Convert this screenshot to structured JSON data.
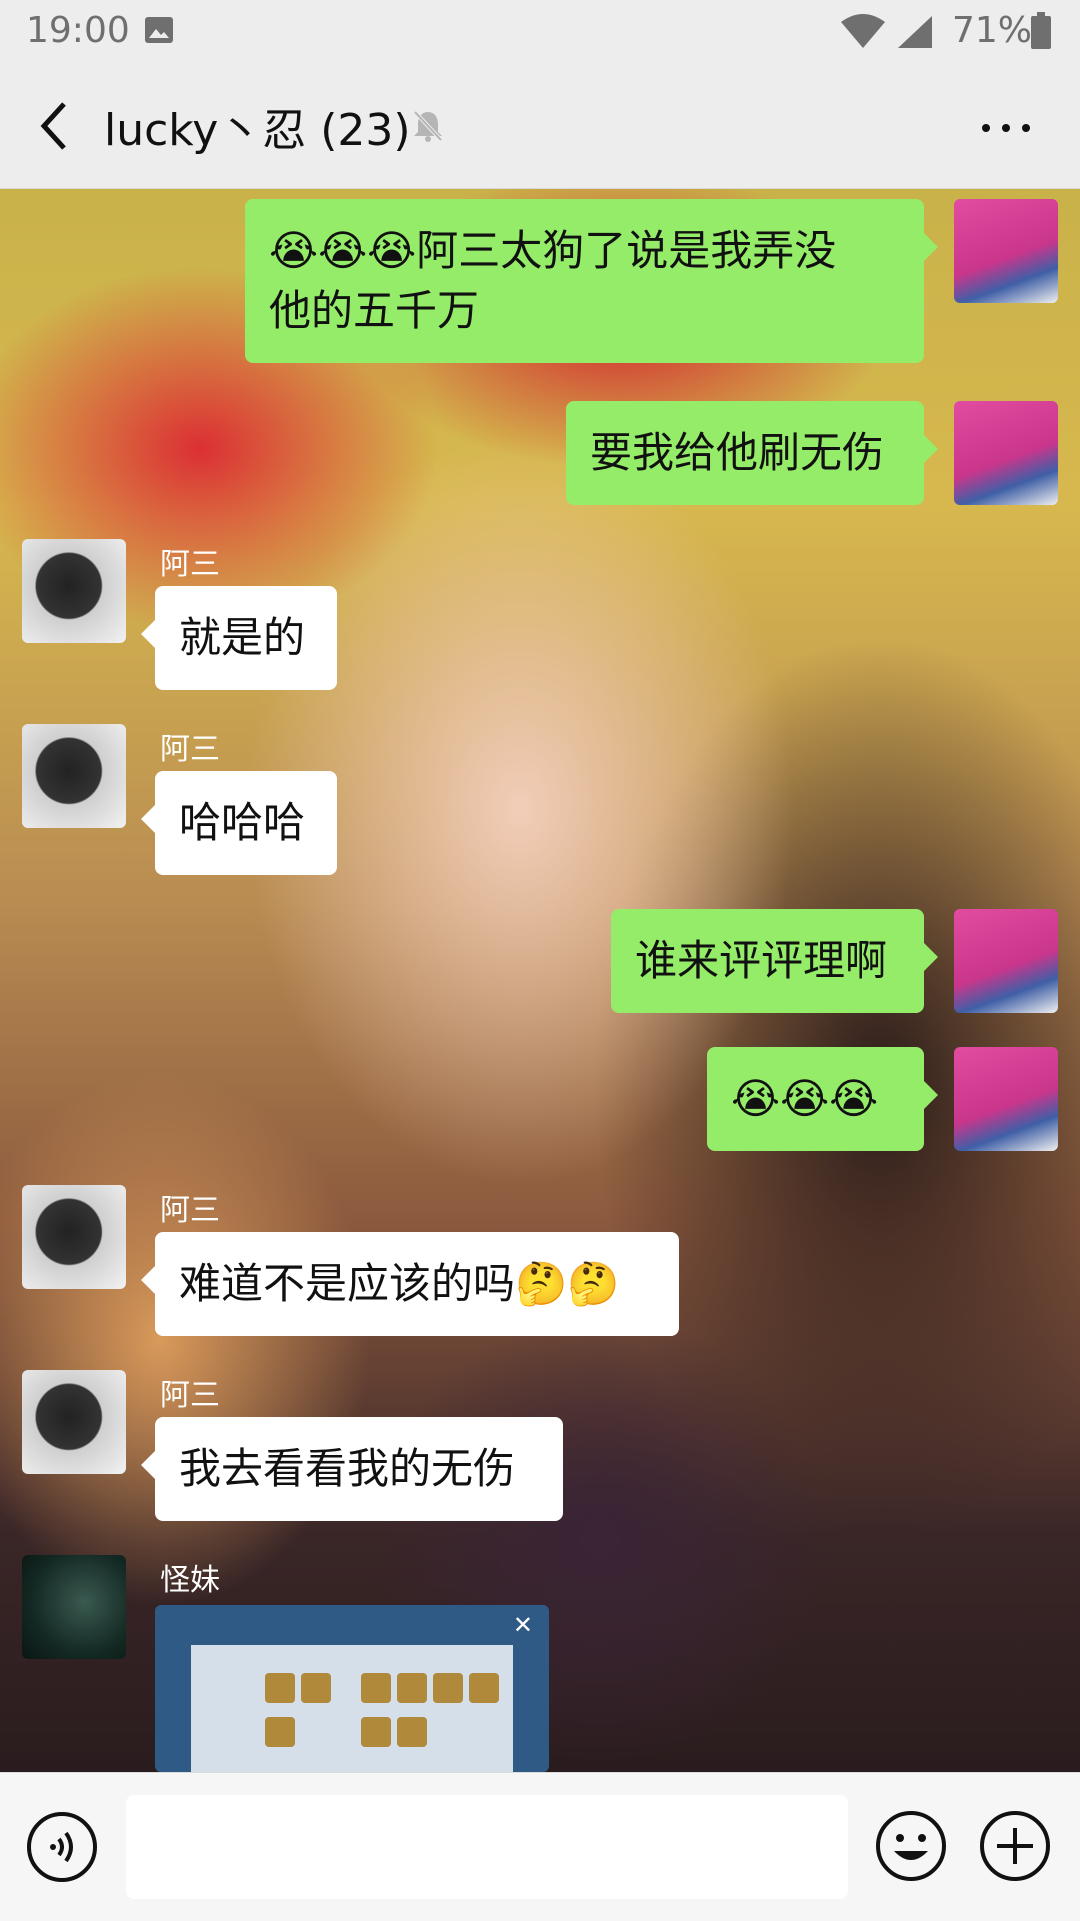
{
  "status_bar": {
    "time": "19:00",
    "battery_percent": "71%"
  },
  "header": {
    "title": "lucky丶忍 (23)",
    "back_icon": "chevron-left-icon",
    "mute_icon": "bell-off-icon",
    "more_icon": "more-dots-icon"
  },
  "colors": {
    "outgoing_bubble": "#95ec69",
    "incoming_bubble": "#ffffff",
    "bar_background": "#ededed"
  },
  "messages": [
    {
      "direction": "out",
      "text": "😭😭😭阿三太狗了说是我弄没\n他的五千万"
    },
    {
      "direction": "out",
      "text": "要我给他刷无伤"
    },
    {
      "direction": "in",
      "sender": "阿三",
      "text": "就是的"
    },
    {
      "direction": "in",
      "sender": "阿三",
      "text": "哈哈哈"
    },
    {
      "direction": "out",
      "text": "谁来评评理啊"
    },
    {
      "direction": "out",
      "text": "😭😭😭"
    },
    {
      "direction": "in",
      "sender": "阿三",
      "text": "难道不是应该的吗🤔🤔"
    },
    {
      "direction": "in",
      "sender": "阿三",
      "text": "我去看看我的无伤"
    },
    {
      "direction": "in",
      "sender": "怪妹",
      "type": "image",
      "text": "",
      "close_glyph": "✕"
    }
  ],
  "input_bar": {
    "voice_icon": "voice-icon",
    "input_value": "",
    "emoji_icon": "emoji-icon",
    "plus_icon": "plus-icon"
  }
}
